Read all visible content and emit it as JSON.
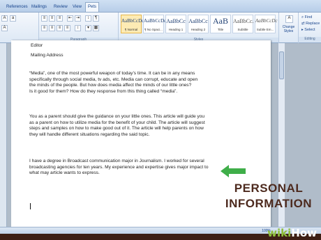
{
  "tabs": [
    "References",
    "Mailings",
    "Review",
    "View",
    "Pets"
  ],
  "ribbon": {
    "groups": {
      "paragraph": "Paragraph",
      "styles": "Styles",
      "editing": "Editing"
    },
    "styles": [
      {
        "sample": "AaBbCcDc",
        "name": "¶ Normal",
        "selected": true
      },
      {
        "sample": "AaBbCcDc",
        "name": "¶ No Spaci...",
        "selected": false
      },
      {
        "sample": "AaBbCc",
        "name": "Heading 1",
        "selected": false
      },
      {
        "sample": "AaBbCc",
        "name": "Heading 2",
        "selected": false
      },
      {
        "sample": "AaB",
        "name": "Title",
        "selected": false
      },
      {
        "sample": "AaBbCc.",
        "name": "Subtitle",
        "selected": false
      },
      {
        "sample": "AaBbCcDc",
        "name": "Subtle Em...",
        "selected": false
      }
    ],
    "change_styles": "Change Styles",
    "editing": {
      "find": "Find",
      "replace": "Replace",
      "select": "Select"
    }
  },
  "document": {
    "editor": "Editor",
    "mailing_address": "Mailing Address",
    "para1": "“Media”, one of the most powerful weapon of today’s time. It can be in any means\nspecifically through social media, tv ads, etc. Media can corrupt, educate and open\nthe minds of the people. But how does media affect the minds of our little ones?\nIs it good for them? How do they response from this thing called “media”.",
    "para2": "You as a parent should give the guidance on your little ones. This article will guide you\nas a parent on how to utilize media for the benefit of your child. The article will suggest\nsteps and samples on how to make good out of it. The article will help parents on how\nthey will handle different situations regarding the said topic.",
    "para3": "I have a degree in Broadcast communication major in Journalism. I worked for several\nbroadcasting agencies for ten years. My experience and expertise gives major impact to\n what may article wants to express."
  },
  "annotation": {
    "line1": "PERSONAL",
    "line2": "INFORMATION",
    "arrow_color": "#3fae49"
  },
  "statusbar": {
    "zoom": "100%"
  },
  "watermark": {
    "wiki": "wiki",
    "how": "How"
  }
}
